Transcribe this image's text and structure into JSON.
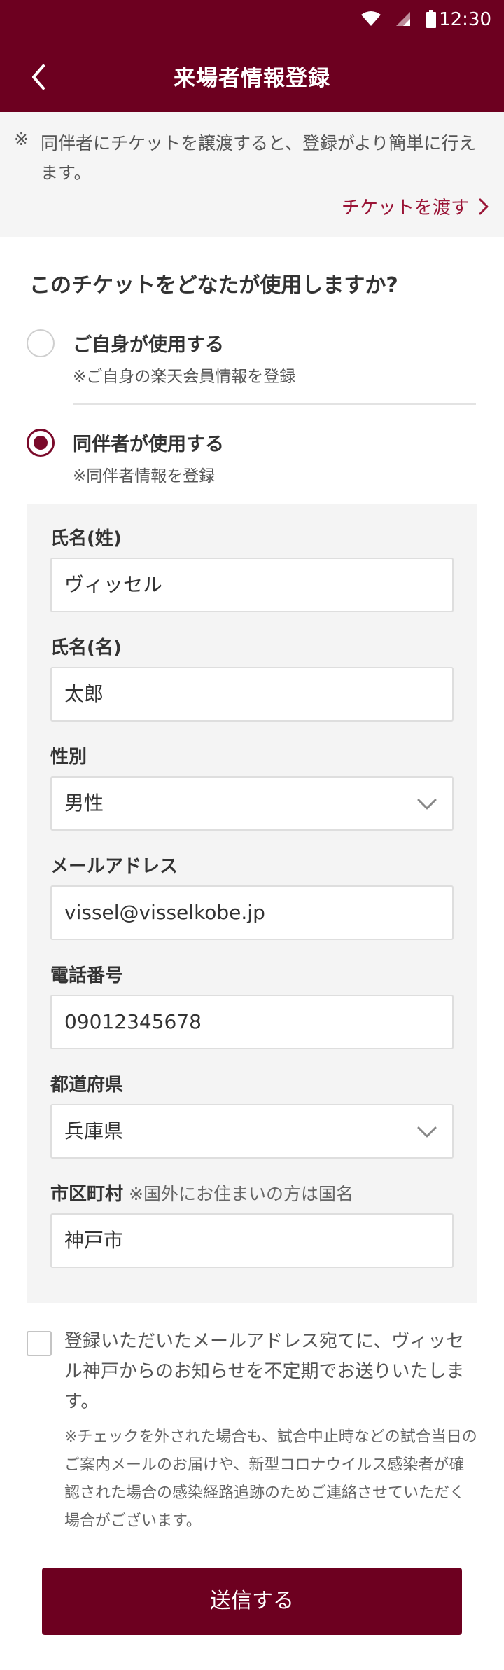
{
  "status_bar": {
    "time": "12:30"
  },
  "header": {
    "title": "来場者情報登録"
  },
  "notice": {
    "mark": "※",
    "text": "同伴者にチケットを譲渡すると、登録がより簡単に行えます。",
    "link_label": "チケットを渡す"
  },
  "question": "このチケットをどなたが使用しますか?",
  "options": [
    {
      "label": "ご自身が使用する",
      "sub": "※ご自身の楽天会員情報を登録",
      "selected": false
    },
    {
      "label": "同伴者が使用する",
      "sub": "※同伴者情報を登録",
      "selected": true
    }
  ],
  "form": {
    "last_name": {
      "label": "氏名(姓)",
      "value": "ヴィッセル"
    },
    "first_name": {
      "label": "氏名(名)",
      "value": "太郎"
    },
    "gender": {
      "label": "性別",
      "value": "男性"
    },
    "email": {
      "label": "メールアドレス",
      "value": "vissel@visselkobe.jp"
    },
    "phone": {
      "label": "電話番号",
      "value": "09012345678"
    },
    "prefecture": {
      "label": "都道府県",
      "value": "兵庫県"
    },
    "city": {
      "label": "市区町村",
      "note": "※国外にお住まいの方は国名",
      "value": "神戸市"
    }
  },
  "consent": {
    "checked": false,
    "text": "登録いただいたメールアドレス宛てに、ヴィッセル神戸からのお知らせを不定期でお送りいたします。",
    "note": "※チェックを外された場合も、試合中止時などの試合当日のご案内メールのお届けや、新型コロナウイルス感染者が確認された場合の感染経路追跡のためご連絡させていただく場合がございます。"
  },
  "submit_label": "送信する",
  "colors": {
    "brand": "#6d0020",
    "link": "#9a1436"
  }
}
